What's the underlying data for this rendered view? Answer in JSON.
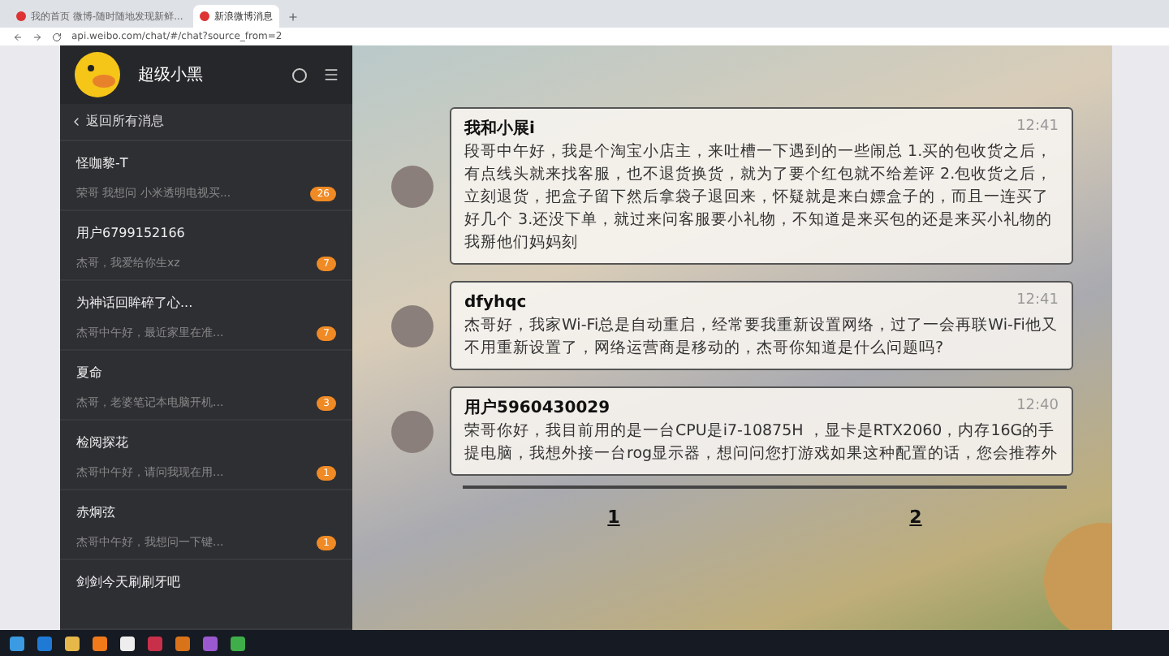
{
  "browser": {
    "tabs": [
      {
        "title": "我的首页 微博-随时随地发现新鲜...",
        "selected": false
      },
      {
        "title": "新浪微博消息",
        "selected": true
      }
    ],
    "address": "api.weibo.com/chat/#/chat?source_from=2"
  },
  "sidebar": {
    "user_name": "超级小黑",
    "back_label": "返回所有消息",
    "conversations": [
      {
        "name": "怪咖黎-T",
        "preview": "荣哥 我想问 小米透明电视买...",
        "badge": "26"
      },
      {
        "name": "用户6799152166",
        "preview": "杰哥，我爱给你生xz",
        "badge": "7"
      },
      {
        "name": "为神话回眸碎了心...",
        "preview": "杰哥中午好，最近家里在准...",
        "badge": "7"
      },
      {
        "name": "夏命",
        "preview": "杰哥，老婆笔记本电脑开机...",
        "badge": "3"
      },
      {
        "name": "检阅探花",
        "preview": "杰哥中午好，请问我现在用...",
        "badge": "1"
      },
      {
        "name": "赤炯弦",
        "preview": "杰哥中午好，我想问一下键...",
        "badge": "1"
      },
      {
        "name": "剑剑今天刷刷牙吧"
      }
    ]
  },
  "messages": [
    {
      "sender": "我和小展i",
      "time": "12:41",
      "text": "段哥中午好，我是个淘宝小店主，来吐槽一下遇到的一些闹总 1.买的包收货之后，有点线头就来找客服，也不退货换货，就为了要个红包就不给差评 2.包收货之后，立刻退货，把盒子留下然后拿袋子退回来，怀疑就是来白嫖盒子的，而且一连买了好几个 3.还没下单，就过来问客服要小礼物，不知道是来买包的还是来买小礼物的我掰他们妈妈刻"
    },
    {
      "sender": "dfyhqc",
      "time": "12:41",
      "text": "杰哥好，我家Wi-Fi总是自动重启，经常要我重新设置网络，过了一会再联Wi-Fi他又不用重新设置了，网络运营商是移动的，杰哥你知道是什么问题吗?"
    },
    {
      "sender": "用户5960430029",
      "time": "12:40",
      "text": "荣哥你好，我目前用的是一台CPU是i7-10875H ，显卡是RTX2060，内存16G的手提电脑，我想外接一台rog显示器，想问问您打游戏如果这种配置的话，您会推荐外"
    }
  ],
  "pagination": [
    "1",
    "2"
  ]
}
